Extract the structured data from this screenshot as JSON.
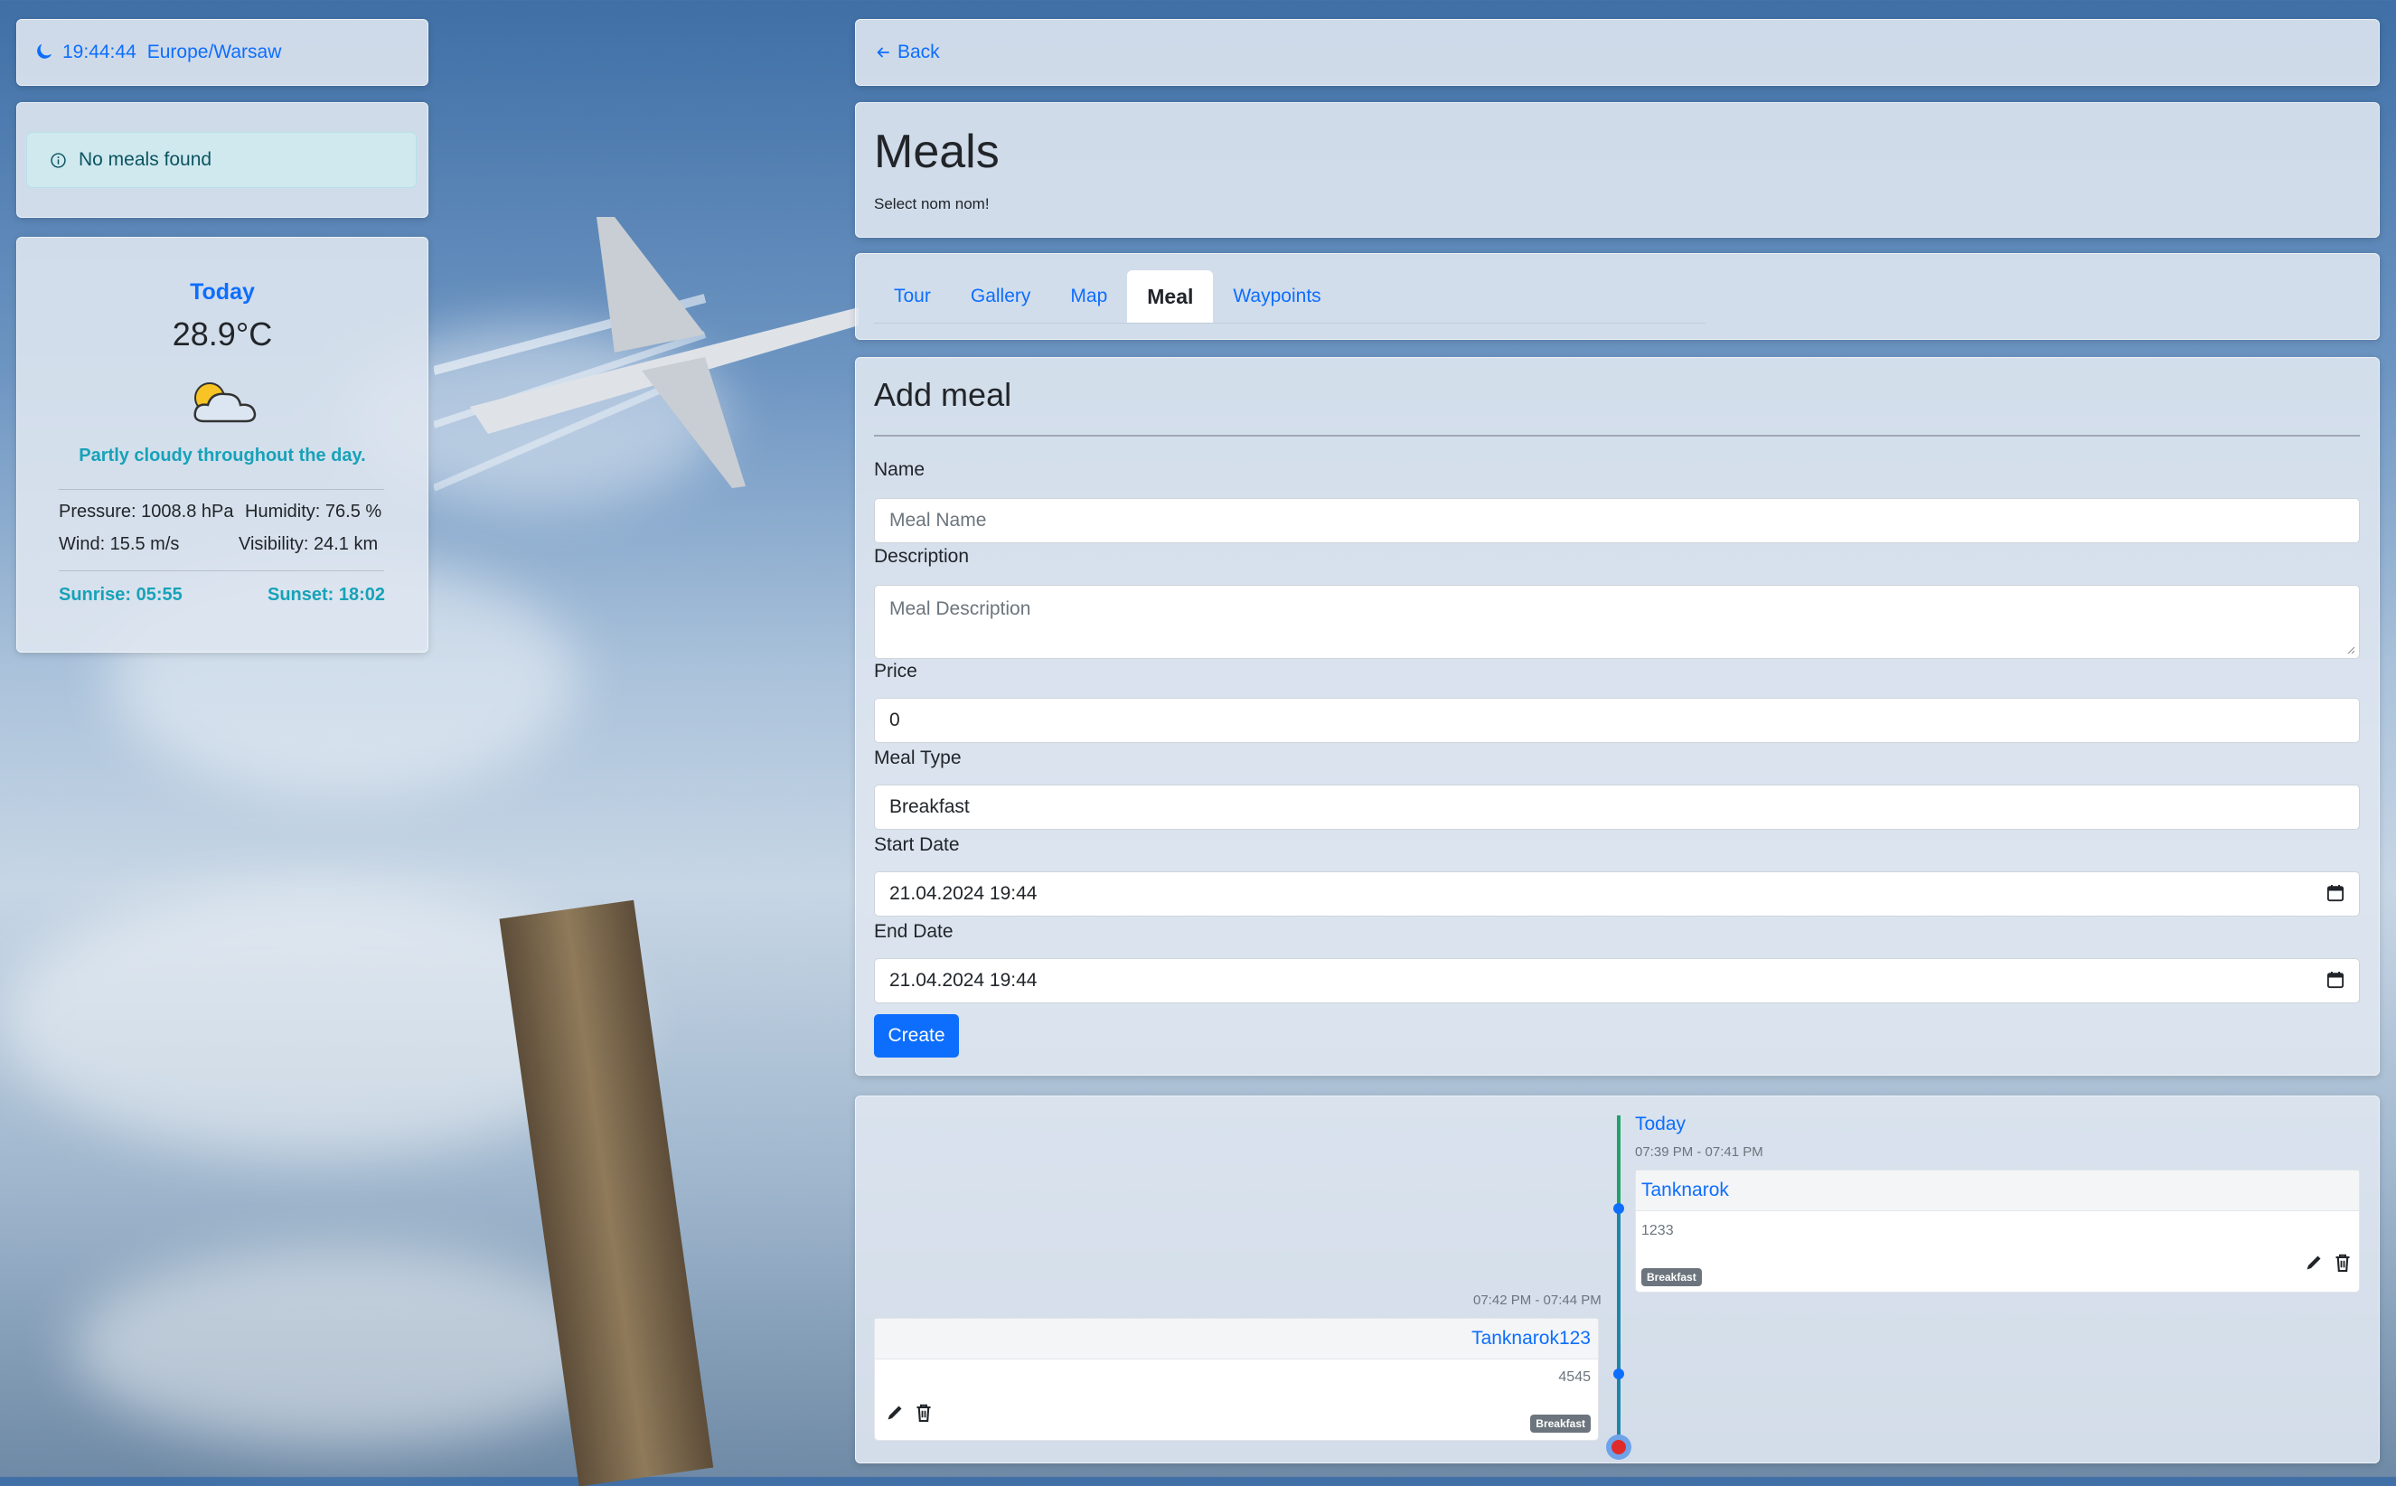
{
  "clock": {
    "time": "19:44:44",
    "timezone": "Europe/Warsaw",
    "icon": "moon-icon"
  },
  "meals_alert": {
    "text": "No meals found",
    "icon": "info-icon"
  },
  "weather": {
    "title": "Today",
    "temperature": "28.9°C",
    "icon": "partly-cloudy-icon",
    "description": "Partly cloudy throughout the day.",
    "pressure": "Pressure: 1008.8 hPa",
    "humidity": "Humidity: 76.5 %",
    "wind": "Wind: 15.5 m/s",
    "visibility": "Visibility: 24.1 km",
    "sunrise": "Sunrise: 05:55",
    "sunset": "Sunset: 18:02"
  },
  "nav": {
    "back_label": "Back"
  },
  "header": {
    "title": "Meals",
    "subtitle": "Select nom nom!"
  },
  "tabs": [
    {
      "label": "Tour",
      "active": false
    },
    {
      "label": "Gallery",
      "active": false
    },
    {
      "label": "Map",
      "active": false
    },
    {
      "label": "Meal",
      "active": true
    },
    {
      "label": "Waypoints",
      "active": false
    }
  ],
  "form": {
    "title": "Add meal",
    "name": {
      "label": "Name",
      "placeholder": "Meal Name"
    },
    "description": {
      "label": "Description",
      "placeholder": "Meal Description"
    },
    "price": {
      "label": "Price",
      "value": "0"
    },
    "meal_type": {
      "label": "Meal Type",
      "value": "Breakfast"
    },
    "start_date": {
      "label": "Start Date",
      "value": "21.04.2024 19:44"
    },
    "end_date": {
      "label": "End Date",
      "value": "21.04.2024 19:44"
    },
    "submit_label": "Create"
  },
  "timeline": {
    "date_label": "Today",
    "items": [
      {
        "time": "07:39 PM - 07:41 PM",
        "name": "Tanknarok",
        "price": "1233",
        "type": "Breakfast"
      },
      {
        "time": "07:42 PM - 07:44 PM",
        "name": "Tanknarok123",
        "price": "4545",
        "type": "Breakfast"
      }
    ]
  },
  "colors": {
    "accent": "#0d6efd",
    "info": "#17a2b8",
    "timeline_line": "#20a26b",
    "now_marker": "#e02b2b"
  }
}
